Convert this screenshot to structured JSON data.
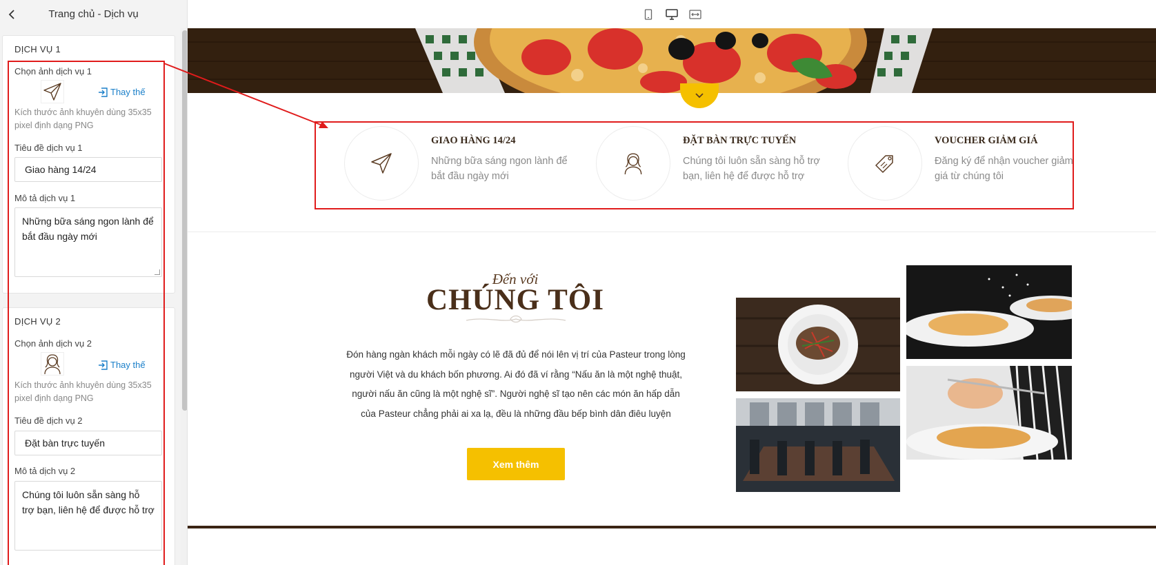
{
  "sidebar": {
    "title": "Trang chủ - Dịch vụ",
    "back_icon": "chevron-left-icon",
    "service1": {
      "heading": "DỊCH VỤ 1",
      "image_label": "Chọn ảnh dịch vụ 1",
      "image_icon": "paper-plane-icon",
      "replace_label": "Thay thế",
      "hint": "Kích thước ảnh khuyên dùng 35x35 pixel định dạng PNG",
      "title_label": "Tiêu đề dịch vụ 1",
      "title_value": "Giao hàng 14/24",
      "desc_label": "Mô tả dịch vụ 1",
      "desc_value": "Những bữa sáng ngon lành để bắt đầu ngày mới"
    },
    "service2": {
      "heading": "DỊCH VỤ 2",
      "image_label": "Chọn ảnh dịch vụ 2",
      "image_icon": "woman-avatar-icon",
      "replace_label": "Thay thế",
      "hint": "Kích thước ảnh khuyên dùng 35x35 pixel định dạng PNG",
      "title_label": "Tiêu đề dịch vụ 2",
      "title_value": "Đặt bàn trực tuyến",
      "desc_label": "Mô tả dịch vụ 2",
      "desc_value": "Chúng tôi luôn sẵn sàng hỗ trợ bạn, liên hệ để được hỗ trợ"
    }
  },
  "toolbar": {
    "devices": [
      "mobile-icon",
      "desktop-icon",
      "fullwidth-icon"
    ],
    "active": "desktop-icon",
    "accent": "#1a7fc9"
  },
  "preview": {
    "services": [
      {
        "title": "GIAO HÀNG 14/24",
        "desc": "Những bữa sáng ngon lành để bắt đầu ngày mới",
        "icon": "paper-plane-icon"
      },
      {
        "title": "ĐẶT BÀN TRỰC TUYẾN",
        "desc": "Chúng tôi luôn sẵn sàng hỗ trợ bạn, liên hệ để được hỗ trợ",
        "icon": "woman-avatar-icon"
      },
      {
        "title": "VOUCHER GIẢM GIÁ",
        "desc": "Đăng ký để nhận voucher giảm giá từ chúng tôi",
        "icon": "price-tag-icon"
      }
    ],
    "about": {
      "subtitle": "Đến với",
      "title": "CHÚNG TÔI",
      "text": "Đón hàng ngàn khách mỗi ngày có lẽ đã đủ để nói lên vị trí của Pasteur trong lòng người Việt và du khách bốn phương. Ai đó đã ví rằng “Nấu ăn là một nghệ thuật, người nấu ăn cũng là một nghệ sĩ”. Người nghệ sĩ tạo nên các món ăn hấp dẫn của Pasteur chẳng phải ai xa lạ, đều là những đầu bếp bình dân điêu luyện",
      "button": "Xem thêm"
    },
    "colors": {
      "accent_yellow": "#f5c000",
      "heading_brown": "#4a2f1a",
      "highlight_red": "#e01b1b"
    }
  }
}
